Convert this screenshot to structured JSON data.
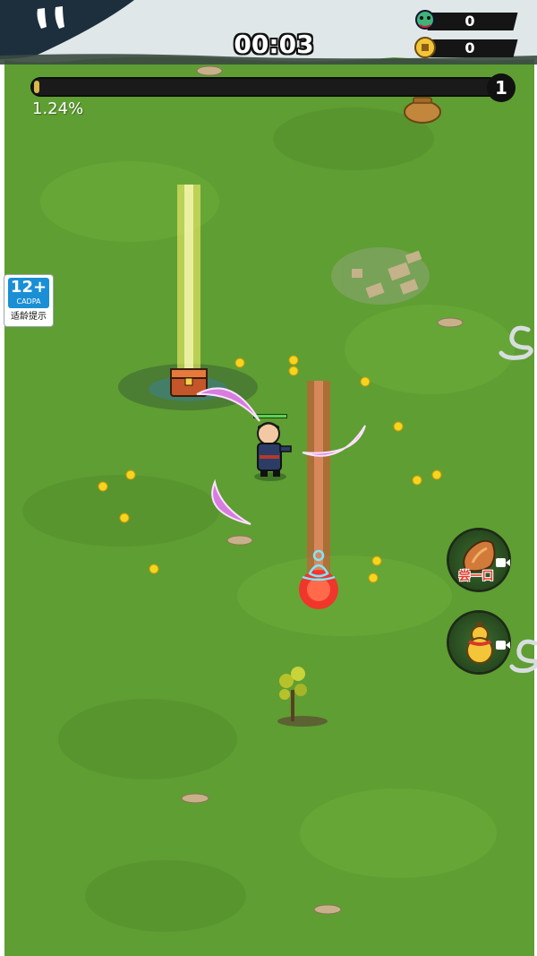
{
  "hud": {
    "timer": "00:03",
    "kills": "0",
    "coins": "0",
    "level": "1",
    "progress_text": "1.24%",
    "progress_fraction": 0.0124
  },
  "age_rating": {
    "rating": "12+",
    "org": "CADPA",
    "note": "适龄提示"
  },
  "skills": [
    {
      "name": "taste",
      "caption": "尝一口"
    },
    {
      "name": "gourd",
      "caption": ""
    }
  ],
  "colors": {
    "grass": "#5f9e32",
    "accent_red": "#e63a2a",
    "coin": "#f2d21b",
    "slash": "#d97fe0",
    "banner": "#dfe7e8"
  }
}
